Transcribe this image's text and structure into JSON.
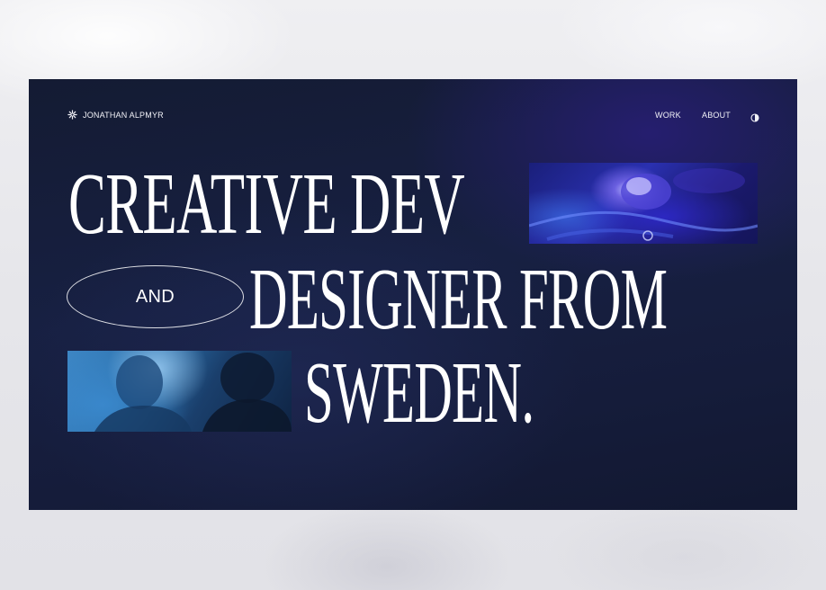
{
  "header": {
    "brand_name": "JONATHAN ALPMYR",
    "brand_icon": "sunburst-icon",
    "nav": {
      "work_label": "WORK",
      "about_label": "ABOUT"
    },
    "theme_toggle_icon": "half-circle-contrast-icon"
  },
  "hero": {
    "line1": "CREATIVE DEV",
    "pill_label": "AND",
    "line2": "DESIGNER FROM",
    "line3": "SWEDEN."
  },
  "colors": {
    "background": "#151c3a",
    "accent_blue": "#2a30b0",
    "text": "#ffffff"
  }
}
